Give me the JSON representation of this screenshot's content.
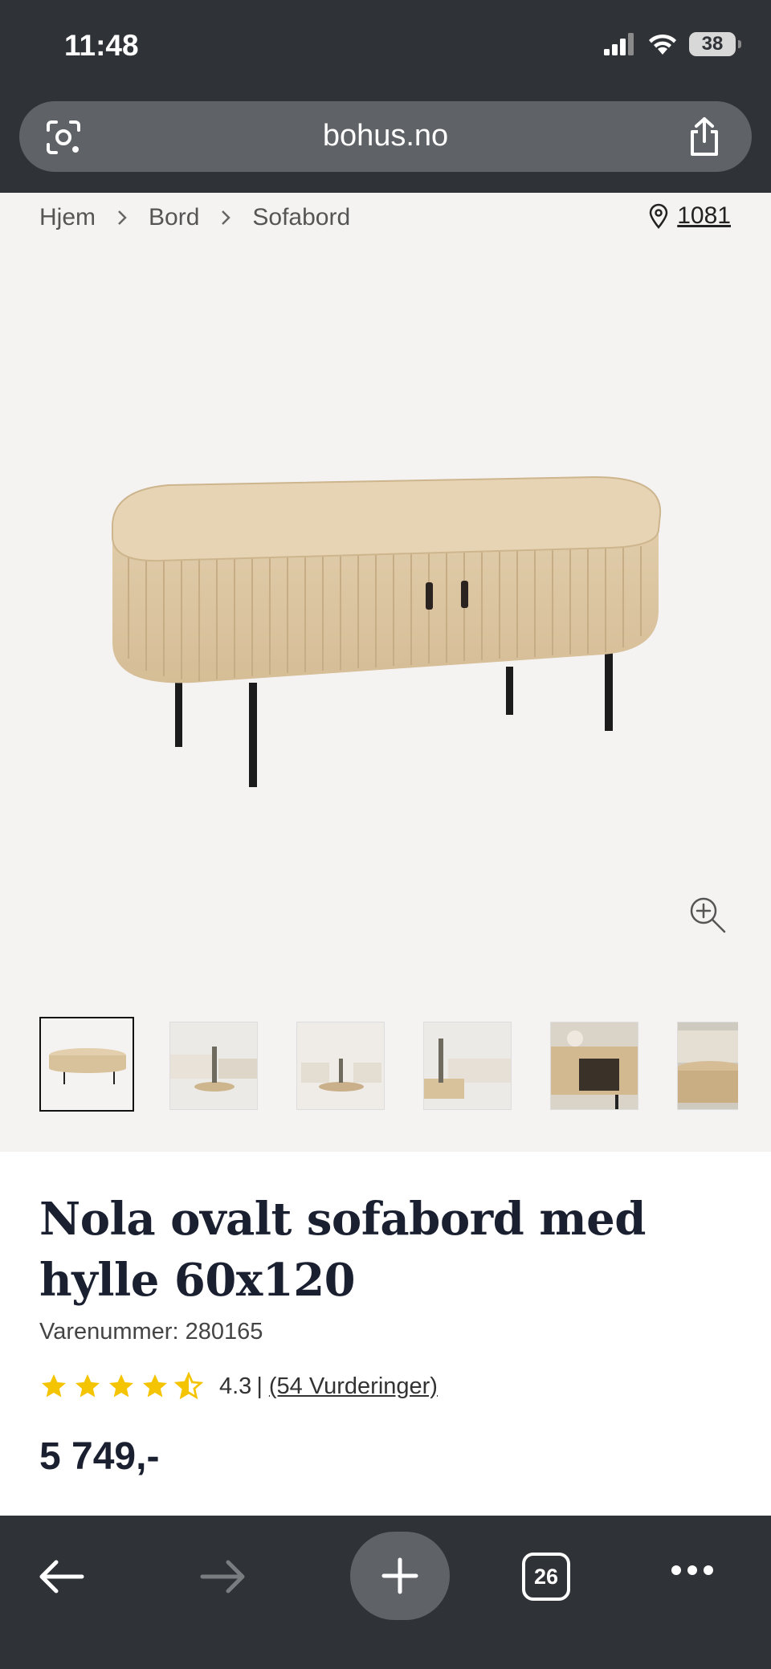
{
  "status_bar": {
    "time": "11:48",
    "battery": "38"
  },
  "browser": {
    "url": "bohus.no",
    "tab_count": "26"
  },
  "breadcrumb": {
    "items": [
      "Hjem",
      "Bord",
      "Sofabord"
    ]
  },
  "store": {
    "code": "1081"
  },
  "product": {
    "title": "Nola ovalt sofabord med hylle 60x120",
    "sku": "Varenummer: 280165",
    "rating": "4.3",
    "rating_separator": "|",
    "reviews": "(54 Vurderinger)",
    "rating_value": 4.3,
    "price": "5 749,-"
  },
  "thumbnails": [
    "table-front",
    "living-room-1",
    "living-room-2",
    "living-room-3",
    "table-detail-open",
    "table-side-closeup"
  ],
  "colors": {
    "star": "#f5c400",
    "title": "#1a2030",
    "chrome": "#2f3236",
    "pill": "#5f6367"
  }
}
